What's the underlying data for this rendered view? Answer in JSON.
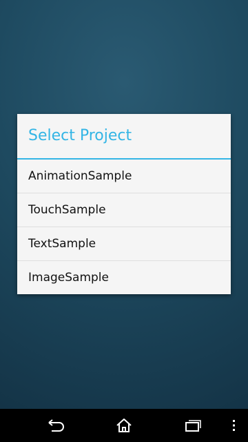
{
  "dialog": {
    "title": "Select Project",
    "items": [
      {
        "label": "AnimationSample"
      },
      {
        "label": "TouchSample"
      },
      {
        "label": "TextSample"
      },
      {
        "label": "ImageSample"
      }
    ]
  },
  "navbar": {
    "buttons": [
      {
        "icon": "back-icon"
      },
      {
        "icon": "home-icon"
      },
      {
        "icon": "recents-icon"
      },
      {
        "icon": "overflow-menu-icon"
      }
    ]
  },
  "colors": {
    "accent": "#33b5e5",
    "background": "#1e4a60",
    "dialog_background": "#f5f5f5",
    "navbar": "#000000"
  }
}
